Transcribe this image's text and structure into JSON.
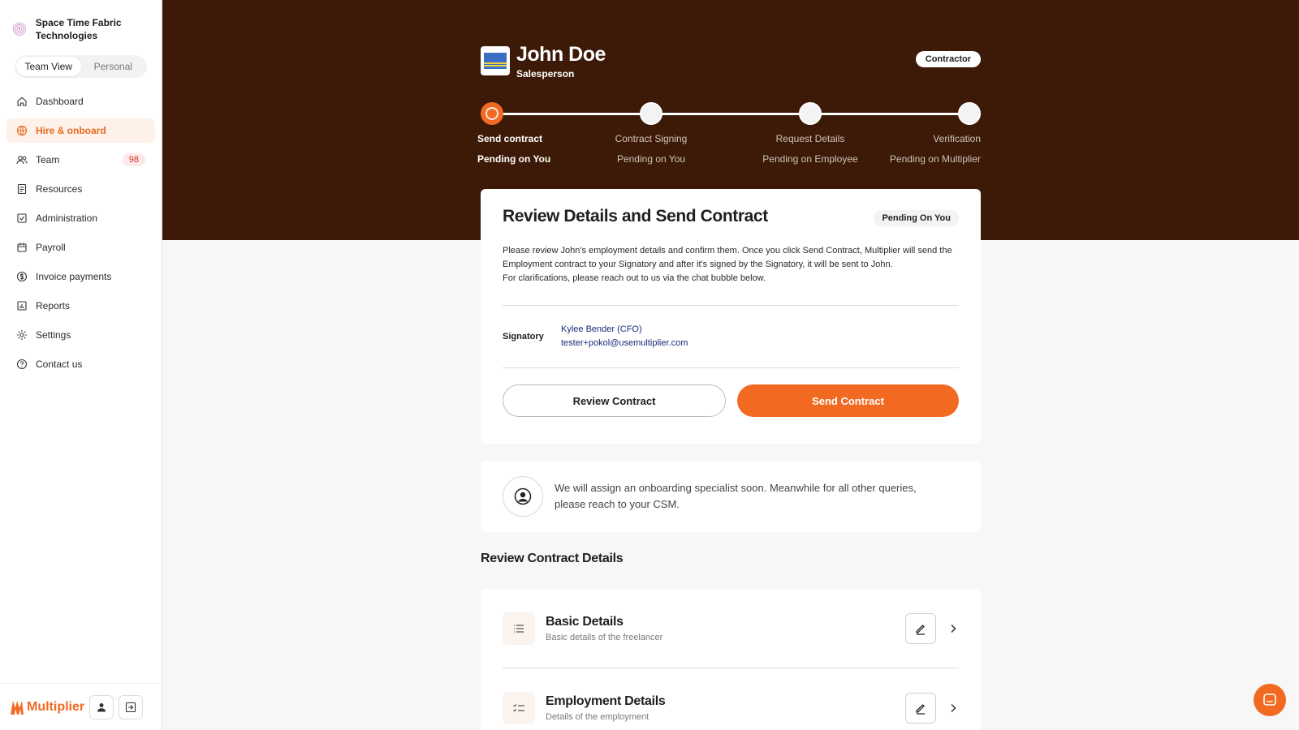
{
  "org": {
    "name": "Space Time Fabric Technologies"
  },
  "view_toggle": {
    "team": "Team View",
    "personal": "Personal"
  },
  "nav": [
    {
      "label": "Dashboard",
      "icon": "home-icon"
    },
    {
      "label": "Hire & onboard",
      "icon": "globe-icon",
      "active": true
    },
    {
      "label": "Team",
      "icon": "users-icon",
      "badge": "98"
    },
    {
      "label": "Resources",
      "icon": "resources-icon"
    },
    {
      "label": "Administration",
      "icon": "checklist-icon"
    },
    {
      "label": "Payroll",
      "icon": "calendar-icon"
    },
    {
      "label": "Invoice payments",
      "icon": "dollar-icon"
    },
    {
      "label": "Reports",
      "icon": "chart-icon"
    },
    {
      "label": "Settings",
      "icon": "gear-icon"
    },
    {
      "label": "Contact us",
      "icon": "help-icon"
    }
  ],
  "brand": {
    "name": "Multiplier",
    "color": "#f26a21"
  },
  "person": {
    "name": "John Doe",
    "role": "Salesperson",
    "type": "Contractor"
  },
  "steps": [
    {
      "label": "Send contract",
      "sub": "Pending on You",
      "current": true
    },
    {
      "label": "Contract Signing",
      "sub": "Pending on You"
    },
    {
      "label": "Request Details",
      "sub": "Pending on Employee"
    },
    {
      "label": "Verification",
      "sub": "Pending on Multiplier"
    }
  ],
  "review": {
    "title": "Review Details and Send Contract",
    "status": "Pending On You",
    "text1": "Please review John's employment details and confirm them. Once you click Send Contract, Multiplier will send the Employment contract to your Signatory and after it's signed by the Signatory, it will be sent to John.",
    "text2": "For clarifications, please reach out to us via the chat bubble below.",
    "signatory_label": "Signatory",
    "signatory_name": "Kylee Bender (CFO)",
    "signatory_email": "tester+pokol@usemultiplier.com",
    "review_btn": "Review Contract",
    "send_btn": "Send Contract"
  },
  "specialist": {
    "text": "We will assign an onboarding specialist soon. Meanwhile for all other queries, please reach to your CSM."
  },
  "contract_details": {
    "title": "Review Contract Details",
    "items": [
      {
        "title": "Basic Details",
        "sub": "Basic details of the freelancer"
      },
      {
        "title": "Employment Details",
        "sub": "Details of the employment"
      }
    ]
  },
  "colors": {
    "header_bg": "#3d1a07",
    "accent": "#f26a21"
  }
}
